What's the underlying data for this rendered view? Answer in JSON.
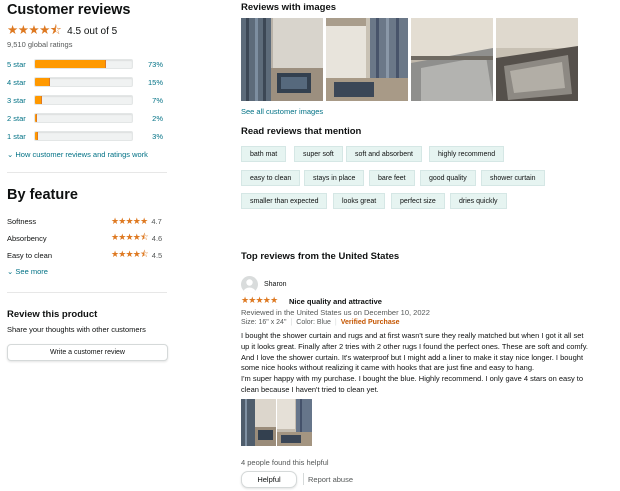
{
  "summary": {
    "title": "Customer reviews",
    "stars": "★★★★⯪",
    "rating_text": "4.5 out of 5",
    "global_ratings": "9,510 global ratings",
    "histogram": [
      {
        "label": "5 star",
        "percent": 73,
        "pct_text": "73%"
      },
      {
        "label": "4 star",
        "percent": 15,
        "pct_text": "15%"
      },
      {
        "label": "3 star",
        "percent": 7,
        "pct_text": "7%"
      },
      {
        "label": "2 star",
        "percent": 2,
        "pct_text": "2%"
      },
      {
        "label": "1 star",
        "percent": 3,
        "pct_text": "3%"
      }
    ],
    "how_link": "How customer reviews and ratings work"
  },
  "by_feature": {
    "title": "By feature",
    "items": [
      {
        "name": "Softness",
        "stars": "★★★★★",
        "value": "4.7"
      },
      {
        "name": "Absorbency",
        "stars": "★★★★⯪",
        "value": "4.6"
      },
      {
        "name": "Easy to clean",
        "stars": "★★★★⯪",
        "value": "4.5"
      }
    ],
    "see_more": "See more"
  },
  "review_product": {
    "title": "Review this product",
    "subtitle": "Share your thoughts with other customers",
    "button": "Write a customer review"
  },
  "images": {
    "title": "Reviews with images",
    "see_all": "See all customer images"
  },
  "mention": {
    "title": "Read reviews that mention",
    "chips": [
      "bath mat",
      "super soft",
      "soft and absorbent",
      "highly recommend",
      "easy to clean",
      "stays in place",
      "bare feet",
      "good quality",
      "shower curtain",
      "smaller than expected",
      "looks great",
      "perfect size",
      "dries quickly"
    ]
  },
  "top_reviews": {
    "title": "Top reviews from the United States",
    "review": {
      "author": "Sharon",
      "stars": "★★★★★",
      "title": "Nice quality and attractive",
      "meta": "Reviewed in the United States us on December 10, 2022",
      "size": "Size: 16\" x 24\"",
      "color": "Color: Blue",
      "verified": "Verified Purchase",
      "body": [
        "I bought the shower curtain and rugs and at first wasn't sure they really matched but when I got it all set",
        "up it looks great. Finally after 2 tries with 2 other rugs I found the perfect ones. These are soft and comfy.",
        "And I love the shower curtain. It's waterproof but I might add a liner to make it stay nice longer. I bought",
        "some nice hooks without realizing it came with hooks that are just fine and easy to hang.",
        "I'm super happy with my purchase. I bought the blue. Highly recommend. I only gave 4 stars on easy to",
        "clean because I haven't tried to clean yet."
      ],
      "helpful_text": "4 people found this helpful",
      "helpful_button": "Helpful",
      "report": "Report abuse"
    }
  }
}
